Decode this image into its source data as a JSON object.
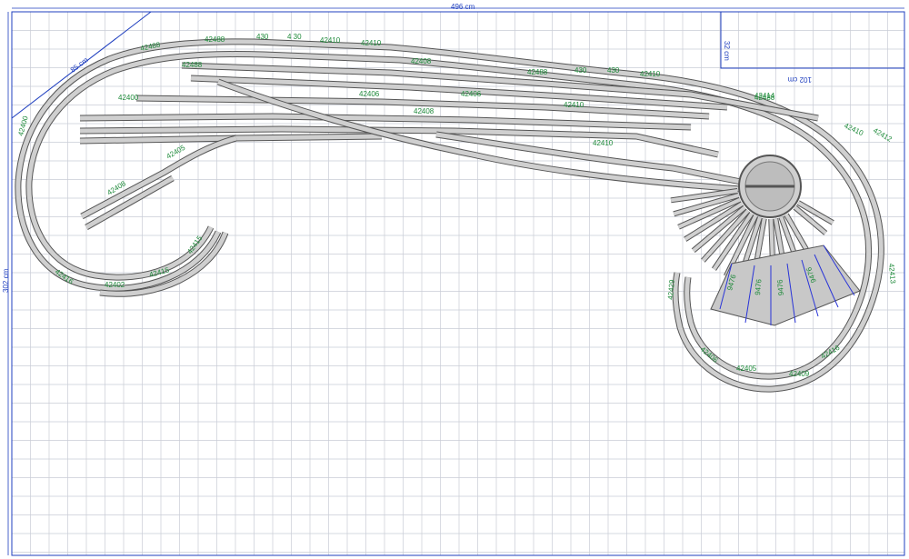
{
  "colors": {
    "grid": "#c9ccd6",
    "dimension": "#1f3fbf",
    "label": "#1e8a3a",
    "track_edge": "#555555",
    "track_fill": "#cfcfcf"
  },
  "dimensions": {
    "width": "496 cm",
    "height": "302 cm",
    "diagonal": "85 cm",
    "notch_width": "102 cm",
    "notch_height": "32 cm"
  },
  "labels": {
    "top_left_curve": [
      "42488",
      "430",
      "4 30",
      "42410",
      "42410",
      "42488",
      "42488"
    ],
    "yard_labels": [
      "42408",
      "42406",
      "42406",
      "42408",
      "42488",
      "430",
      "430",
      "42410",
      "42410",
      "42410",
      "42414"
    ],
    "left_loop": [
      "42400",
      "42408",
      "42405",
      "42402",
      "42415",
      "42416",
      "42400",
      "42415"
    ],
    "right_loop": [
      "42488",
      "42410",
      "42412",
      "42413",
      "42405",
      "42409",
      "42416",
      "42429",
      "42406"
    ],
    "turntable_tracks": [
      "9476",
      "9476",
      "9476",
      "9476"
    ]
  }
}
